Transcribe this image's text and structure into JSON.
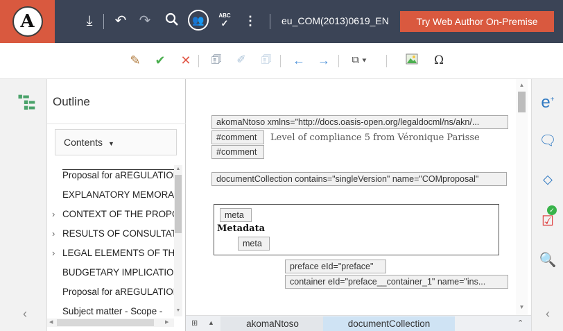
{
  "topbar": {
    "logo_letter": "A",
    "doc_title": "eu_COM(2013)0619_EN",
    "try_button": "Try Web Author On-Premise",
    "spell_abc": "ABC",
    "icons": [
      "download-icon",
      "undo-icon",
      "redo-icon",
      "search-icon",
      "people-icon",
      "spellcheck-icon",
      "more-icon"
    ]
  },
  "toolbar2": {
    "icons": [
      "track-changes-icon",
      "accept-icon",
      "reject-icon",
      "add-comment-icon",
      "edit-comment-icon",
      "remove-comment-icon",
      "previous-icon",
      "next-icon",
      "paste-icon",
      "image-icon",
      "special-char-icon"
    ],
    "omega": "Ω"
  },
  "outline": {
    "title": "Outline",
    "dropdown_label": "Contents",
    "items": [
      {
        "label": "Proposal for aREGULATION",
        "arrow": ""
      },
      {
        "label": "EXPLANATORY MEMORANDUM",
        "arrow": ""
      },
      {
        "label": "CONTEXT OF THE PROPOSAL",
        "arrow": "›"
      },
      {
        "label": "RESULTS OF CONSULTATIONS",
        "arrow": "›"
      },
      {
        "label": "LEGAL ELEMENTS OF THE PROPOSAL",
        "arrow": "›"
      },
      {
        "label": "BUDGETARY IMPLICATION",
        "arrow": ""
      },
      {
        "label": "Proposal for aREGULATION",
        "arrow": ""
      },
      {
        "label": "Subject matter - Scope -",
        "arrow": ""
      }
    ]
  },
  "editor": {
    "akn_tag": "akomaNtoso xmlns=\"http://docs.oasis-open.org/legaldocml/ns/akn/...",
    "comment_open": "#comment",
    "comment_text": "Level of compliance 5 from Véronique Parisse",
    "comment_close": "#comment",
    "doc_collection": "documentCollection contains=\"singleVersion\" name=\"COMproposal\"",
    "meta_open": "meta",
    "metadata_label": "Metadata",
    "meta_close": "meta",
    "preface_tag": "preface eId=\"preface\"",
    "container_tag": "container eId=\"preface__container_1\" name=\"ins..."
  },
  "breadcrumb": {
    "items": [
      "akomaNtoso",
      "documentCollection"
    ]
  },
  "right_rail": {
    "icons": [
      "add-comment-e-icon",
      "comments-icon",
      "tags-icon",
      "validation-icon",
      "find-icon"
    ]
  },
  "colors": {
    "topbar_bg": "#3b4456",
    "accent": "#d9593f",
    "icon_blue": "#2f79c2",
    "breadcrumb_active": "#cfe3f4"
  }
}
